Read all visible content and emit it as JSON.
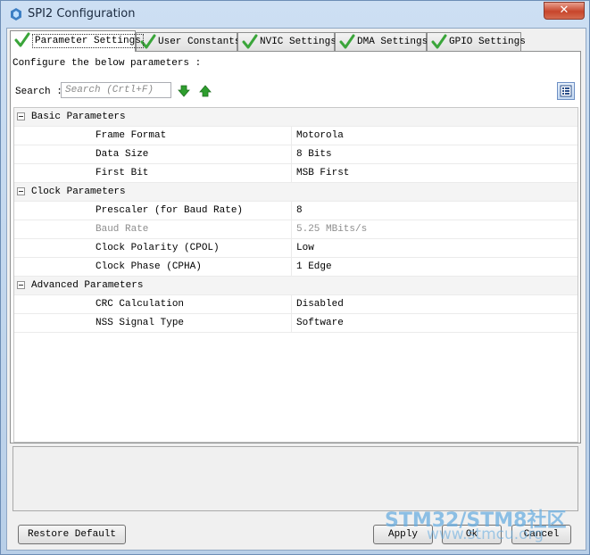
{
  "window": {
    "title": "SPI2 Configuration",
    "close_label": "✕"
  },
  "tabs": [
    {
      "label": "Parameter Settings",
      "active": true
    },
    {
      "label": "User Constants",
      "active": false
    },
    {
      "label": "NVIC Settings",
      "active": false
    },
    {
      "label": "DMA Settings",
      "active": false
    },
    {
      "label": "GPIO Settings",
      "active": false
    }
  ],
  "panel": {
    "instruction": "Configure the below parameters :",
    "search_label": "Search :",
    "search_placeholder": "Search (Crtl+F)"
  },
  "groups": [
    {
      "label": "Basic Parameters",
      "params": [
        {
          "name": "Frame Format",
          "value": "Motorola"
        },
        {
          "name": "Data Size",
          "value": "8 Bits"
        },
        {
          "name": "First Bit",
          "value": "MSB First"
        }
      ]
    },
    {
      "label": "Clock Parameters",
      "params": [
        {
          "name": "Prescaler (for Baud Rate)",
          "value": "8"
        },
        {
          "name": "Baud Rate",
          "value": "5.25 MBits/s"
        },
        {
          "name": "Clock Polarity (CPOL)",
          "value": "Low"
        },
        {
          "name": "Clock Phase (CPHA)",
          "value": "1 Edge"
        }
      ]
    },
    {
      "label": "Advanced Parameters",
      "params": [
        {
          "name": "CRC Calculation",
          "value": "Disabled"
        },
        {
          "name": "NSS Signal Type",
          "value": "Software"
        }
      ]
    }
  ],
  "buttons": {
    "restore_default": "Restore Default",
    "apply": "Apply",
    "ok": "Ok",
    "cancel": "Cancel"
  },
  "watermark": {
    "brand": "STM32/STM8社区",
    "site": "www.stmcu.org"
  },
  "colors": {
    "check_green": "#3aa53a",
    "arrow_green": "#2e9e2e",
    "disabled_text": "#8d8d8d"
  },
  "icons": {
    "tab_status": "check-icon",
    "search_next": "arrow-down-icon",
    "search_prev": "arrow-up-icon",
    "view_toggle": "list-view-icon"
  }
}
